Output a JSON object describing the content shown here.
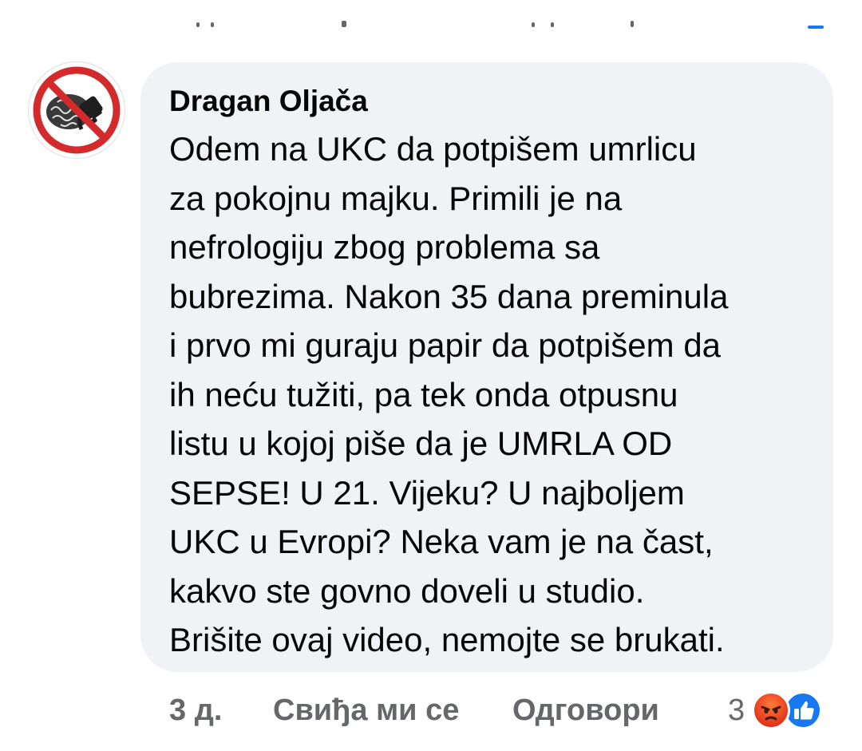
{
  "comment": {
    "author": "Dragan Oljača",
    "text_lines": [
      "Odem na UKC da potpišem umrlicu",
      "za pokojnu majku. Primili je na",
      "nefrologiju zbog problema sa",
      "bubrezima. Nakon 35 dana preminula",
      "i prvo mi guraju papir da potpišem da",
      "ih neću tužiti, pa tek onda otpusnu",
      "listu u kojoj piše da je UMRLA OD",
      "SEPSE! U 21. Vijeku? U najboljem",
      "UKC u Evropi? Neka vam je na čast,",
      "kakvo ste govno doveli u studio.",
      "Brišite ovaj video, nemojte se brukati."
    ],
    "avatar_icon": "no-brain-plug-icon"
  },
  "actions": {
    "timestamp": "3 д.",
    "like_label": "Свиђа ми се",
    "reply_label": "Одговори"
  },
  "reactions": {
    "count": "3",
    "icons": [
      "angry-reaction-icon",
      "like-reaction-icon"
    ]
  },
  "colors": {
    "bubble_background": "#f0f2f5",
    "text": "#050505",
    "meta_text": "#65676b",
    "like_blue": "#1877f2",
    "angry_orange": "#f0542a",
    "prohibition_red": "#d32b2b"
  }
}
